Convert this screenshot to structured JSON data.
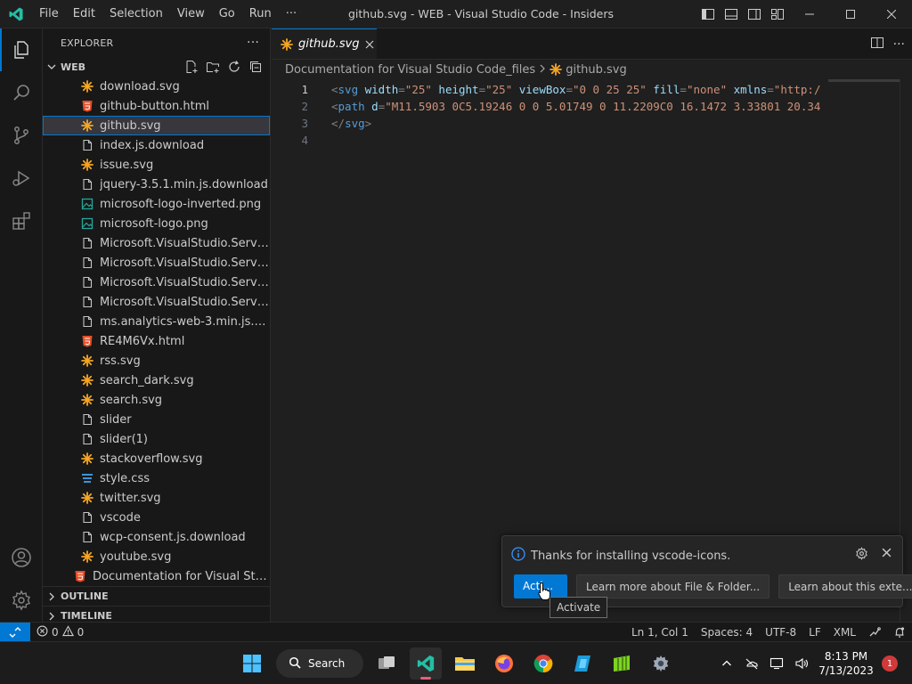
{
  "titlebar": {
    "menu": [
      "File",
      "Edit",
      "Selection",
      "View",
      "Go",
      "Run",
      "···"
    ],
    "title": "github.svg - WEB - Visual Studio Code - Insiders"
  },
  "explorer": {
    "header": "EXPLORER",
    "more": "···",
    "root": "WEB",
    "files": [
      {
        "name": "download.svg",
        "icon": "svg-icon"
      },
      {
        "name": "github-button.html",
        "icon": "html-icon"
      },
      {
        "name": "github.svg",
        "icon": "svg-icon"
      },
      {
        "name": "index.js.download",
        "icon": "file-icon"
      },
      {
        "name": "issue.svg",
        "icon": "svg-icon"
      },
      {
        "name": "jquery-3.5.1.min.js.download",
        "icon": "file-icon"
      },
      {
        "name": "microsoft-logo-inverted.png",
        "icon": "image-icon"
      },
      {
        "name": "microsoft-logo.png",
        "icon": "image-icon"
      },
      {
        "name": "Microsoft.VisualStudio.Services....",
        "icon": "file-icon"
      },
      {
        "name": "Microsoft.VisualStudio.Services....",
        "icon": "file-icon"
      },
      {
        "name": "Microsoft.VisualStudio.Services....",
        "icon": "file-icon"
      },
      {
        "name": "Microsoft.VisualStudio.Services....",
        "icon": "file-icon"
      },
      {
        "name": "ms.analytics-web-3.min.js.down...",
        "icon": "file-icon"
      },
      {
        "name": "RE4M6Vx.html",
        "icon": "html-icon"
      },
      {
        "name": "rss.svg",
        "icon": "svg-icon"
      },
      {
        "name": "search_dark.svg",
        "icon": "svg-icon"
      },
      {
        "name": "search.svg",
        "icon": "svg-icon"
      },
      {
        "name": "slider",
        "icon": "file-icon"
      },
      {
        "name": "slider(1)",
        "icon": "file-icon"
      },
      {
        "name": "stackoverflow.svg",
        "icon": "svg-icon"
      },
      {
        "name": "style.css",
        "icon": "css-icon"
      },
      {
        "name": "twitter.svg",
        "icon": "svg-icon"
      },
      {
        "name": "vscode",
        "icon": "file-icon"
      },
      {
        "name": "wcp-consent.js.download",
        "icon": "file-icon"
      },
      {
        "name": "youtube.svg",
        "icon": "svg-icon"
      }
    ],
    "selected_index": 2,
    "root_file": "Documentation for Visual Studio...",
    "outline": "OUTLINE",
    "timeline": "TIMELINE"
  },
  "editor": {
    "tab_label": "github.svg",
    "breadcrumb_folder": "Documentation for Visual Studio Code_files",
    "breadcrumb_file": "github.svg",
    "lines": [
      {
        "n": "1",
        "tokens": [
          [
            "t-tag",
            "<"
          ],
          [
            "t-name",
            "svg"
          ],
          [
            "t-attr",
            " width"
          ],
          [
            "t-tag",
            "="
          ],
          [
            "t-str",
            "\"25\""
          ],
          [
            "t-attr",
            " height"
          ],
          [
            "t-tag",
            "="
          ],
          [
            "t-str",
            "\"25\""
          ],
          [
            "t-attr",
            " viewBox"
          ],
          [
            "t-tag",
            "="
          ],
          [
            "t-str",
            "\"0 0 25 25\""
          ],
          [
            "t-attr",
            " fill"
          ],
          [
            "t-tag",
            "="
          ],
          [
            "t-str",
            "\"none\""
          ],
          [
            "t-attr",
            " xmlns"
          ],
          [
            "t-tag",
            "="
          ],
          [
            "t-str",
            "\"http:/"
          ]
        ]
      },
      {
        "n": "2",
        "tokens": [
          [
            "t-tag",
            "<"
          ],
          [
            "t-name",
            "path"
          ],
          [
            "t-attr",
            " d"
          ],
          [
            "t-tag",
            "="
          ],
          [
            "t-str",
            "\"M11.5903 0C5.19246 0 0 5.01749 0 11.2209C0 16.1472 3.33801 20.34"
          ]
        ]
      },
      {
        "n": "3",
        "tokens": [
          [
            "t-tag",
            "</"
          ],
          [
            "t-name",
            "svg"
          ],
          [
            "t-tag",
            ">"
          ]
        ]
      },
      {
        "n": "4",
        "tokens": []
      }
    ]
  },
  "notification": {
    "message": "Thanks for installing vscode-icons.",
    "buttons": [
      "Acti...",
      "Learn more about File & Folder...",
      "Learn about this exte..."
    ],
    "tooltip": "Activate"
  },
  "statusbar": {
    "errors": "0",
    "warnings": "0",
    "position": "Ln 1, Col 1",
    "spaces": "Spaces: 4",
    "encoding": "UTF-8",
    "eol": "LF",
    "language": "XML"
  },
  "taskbar": {
    "search": "Search",
    "time": "8:13 PM",
    "date": "7/13/2023",
    "notifications": "1"
  },
  "colors": {
    "accent": "#0078d4",
    "svg_icon": "#f5a623",
    "html_icon": "#e44d26",
    "css_icon": "#42a5f5",
    "image_icon": "#26a69a"
  }
}
